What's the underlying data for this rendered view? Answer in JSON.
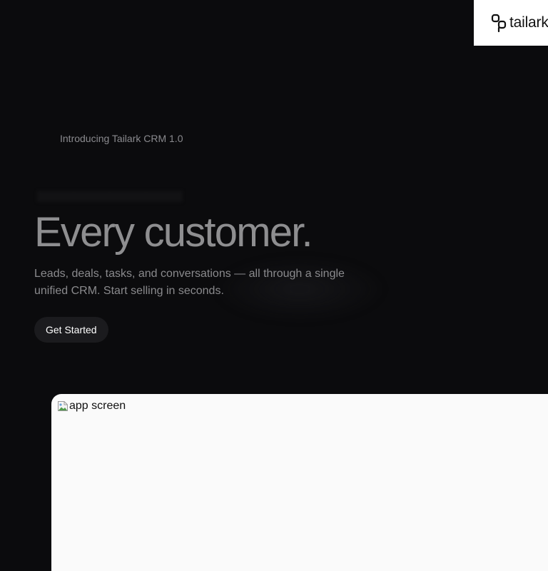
{
  "brand": {
    "name": "tailark",
    "logo_icon": "tailark-logo-icon"
  },
  "hero": {
    "badge": "Introducing Tailark CRM 1.0",
    "title": "Every customer.",
    "subtitle": "Leads, deals, tasks, and conversations — all through a single unified CRM. Start selling in seconds.",
    "cta_label": "Get Started"
  },
  "app_preview": {
    "alt": "app screen",
    "icon": "broken-image-icon"
  },
  "colors": {
    "background": "#0b0b0d",
    "title": "#8e8e90",
    "text_muted": "#8a8a8d",
    "button_bg": "#1b1b1e",
    "card_bg": "#fafafa"
  }
}
